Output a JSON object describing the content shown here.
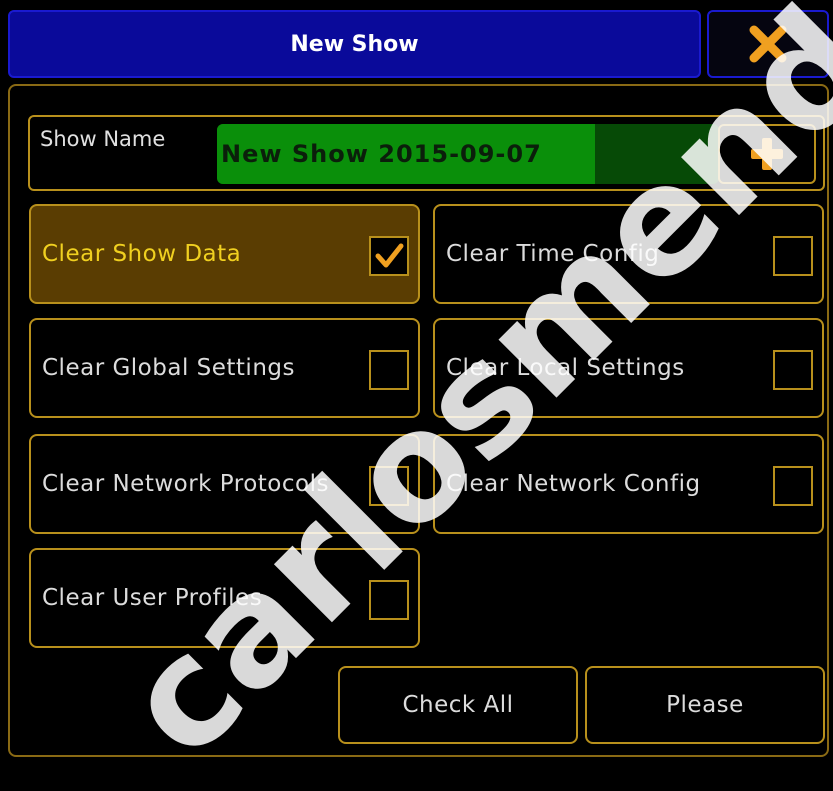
{
  "window": {
    "title": "New Show",
    "close_icon": "close-x-icon"
  },
  "show_name": {
    "label": "Show Name",
    "value": "New Show 2015-09-07",
    "add_icon": "plus-icon"
  },
  "options": [
    {
      "label": "Clear Show Data",
      "checked": true
    },
    {
      "label": "Clear Time Config",
      "checked": false
    },
    {
      "label": "Clear Global Settings",
      "checked": false
    },
    {
      "label": "Clear Local Settings",
      "checked": false
    },
    {
      "label": "Clear Network Protocols",
      "checked": false
    },
    {
      "label": "Clear Network Config",
      "checked": false
    },
    {
      "label": "Clear User Profiles",
      "checked": false
    }
  ],
  "buttons": {
    "check_all": "Check All",
    "please": "Please"
  },
  "watermark": "carlosmendoza",
  "colors": {
    "title_bar": "#0a0a9a",
    "accent": "#b8901c",
    "close_x": "#f0a020",
    "field_green": "#0a8f0a",
    "active_option": "#5a3d02",
    "active_text": "#f0d020"
  }
}
